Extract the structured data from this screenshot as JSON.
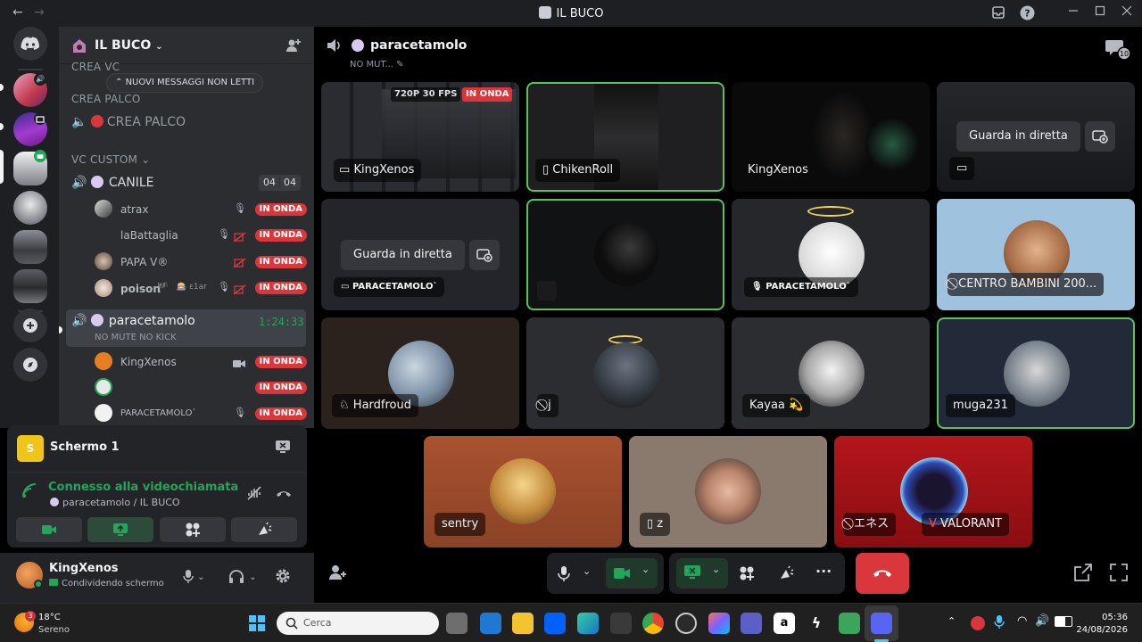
{
  "window": {
    "title": "IL BUCO",
    "back_icon": "←",
    "forward_icon": "→"
  },
  "sidebar": {
    "server_name": "IL BUCO",
    "unread_banner": "NUOVI MESSAGGI NON LETTI",
    "cat_crea_vc": "CREA VC",
    "cat_crea_palco": "CREA PALCO",
    "chan_crea_palco": "CREA PALCO",
    "cat_vc_custom": "VC CUSTOM",
    "chan_canile": "CANILE",
    "canile_count_a": "04",
    "canile_count_b": "04",
    "canile_users": [
      {
        "name": "atrax",
        "badge": "IN ONDA"
      },
      {
        "name": "laBattaglia",
        "badge": "IN ONDA"
      },
      {
        "name": "PAPA V®",
        "badge": "IN ONDA"
      },
      {
        "name": "poison",
        "badge": "IN ONDA"
      }
    ],
    "poison_extra_a": "🏴",
    "poison_extra_b": "🎰 ε1ar",
    "chan_parac": "paracetamolo",
    "parac_timer": "1:24:33",
    "parac_status": "NO MUTE NO KICK",
    "parac_users": [
      {
        "name": "KingXenos",
        "badge": "IN ONDA"
      },
      {
        "name": "",
        "badge": "IN ONDA"
      },
      {
        "name": "PARACETAMOLO`",
        "badge": "IN ONDA"
      }
    ]
  },
  "voice": {
    "stream_title": "Schermo 1",
    "connected": "Connesso alla videochiamata",
    "location": "paracetamolo / IL BUCO"
  },
  "user": {
    "name": "KingXenos",
    "status": "Condividendo schermo"
  },
  "stage": {
    "channel": "paracetamolo",
    "status": "NO MUT...",
    "inbox_count": "10",
    "tiles": {
      "t1_name": "KingXenos",
      "t1_q": "720P 30 FPS",
      "t1_live": "IN ONDA",
      "t2_name": "ChikenRoll",
      "t3_name": "KingXenos",
      "t4_watch": "Guarda in diretta",
      "t5_watch": "Guarda in diretta",
      "t5_name": "PARACETAMOLO`",
      "t7_name": "PARACETAMOLO`",
      "t8_name": "CENTRO BAMBINI 200...",
      "t9_name": "Hardfroud",
      "t10_name": "j",
      "t11_name": "Kayaa 💫",
      "t12_name": "muga231",
      "t13_name": "sentry",
      "t14_name": "z",
      "t15_name": "エネス",
      "t15_game": "VALORANT"
    }
  },
  "taskbar": {
    "temp": "18°C",
    "weather": "Sereno",
    "weather_badge": "3",
    "search": "Cerca",
    "time": "05:36",
    "date": "24/08/2026"
  },
  "colors": {
    "accent_green": "#23a55a",
    "live_red": "#da373c",
    "end_call": "#da373c",
    "blurple": "#5865f2"
  }
}
